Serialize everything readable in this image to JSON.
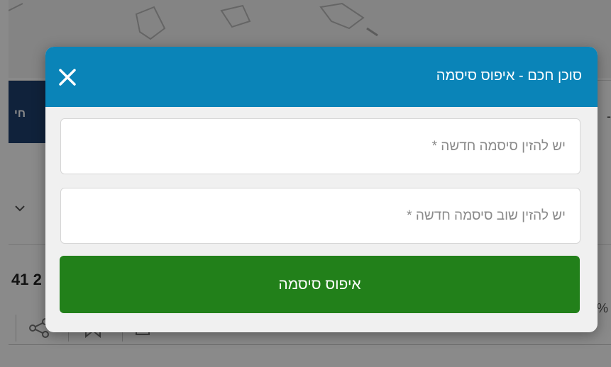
{
  "background": {
    "nav_tab_label": "חי",
    "nav_right_glyph": "-",
    "number_fragment": "41 2",
    "percent_fragment": "%"
  },
  "modal": {
    "title": "סוכן חכם - איפוס סיסמה",
    "close_icon": "close-icon",
    "new_password": {
      "value": "",
      "placeholder": "יש להזין סיסמה חדשה *"
    },
    "confirm_password": {
      "value": "",
      "placeholder": "יש להזין שוב סיסמה חדשה *"
    },
    "submit_label": "איפוס סיסמה"
  },
  "colors": {
    "header": "#0a84b8",
    "submit": "#22801a",
    "modal_bg": "#f0f0f0"
  }
}
